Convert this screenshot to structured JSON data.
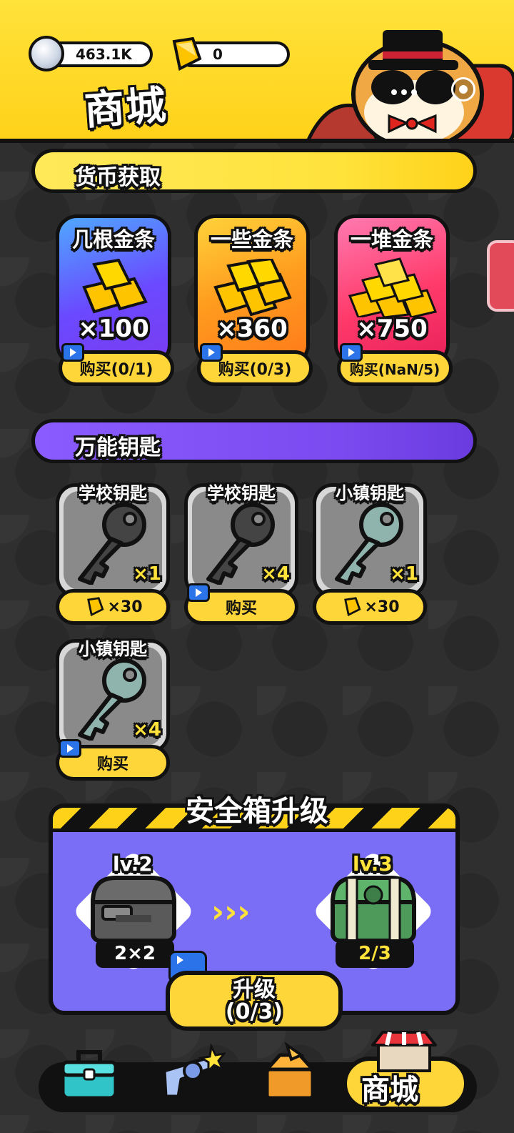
{
  "header": {
    "silver_amount": "463.1K",
    "gold_amount": "0",
    "title": "商城"
  },
  "sections": {
    "currency_title": "货币获取",
    "keys_title": "万能钥匙"
  },
  "gold_packs": [
    {
      "name": "几根金条",
      "qty": "×100",
      "buy": "购买(0/1)",
      "color": "#6a49ff"
    },
    {
      "name": "一些金条",
      "qty": "×360",
      "buy": "购买(0/3)",
      "color": "#ff8a1e"
    },
    {
      "name": "一堆金条",
      "qty": "×750",
      "buy": "购买(NaN/5)",
      "color": "#ff3b6b"
    }
  ],
  "keys": [
    {
      "name": "学校钥匙",
      "qty": "×1",
      "buy": "×30",
      "price_type": "gold-bar",
      "key_color": "#444444"
    },
    {
      "name": "学校钥匙",
      "qty": "×4",
      "buy": "购买",
      "price_type": "video-ad",
      "key_color": "#444444"
    },
    {
      "name": "小镇钥匙",
      "qty": "×1",
      "buy": "×30",
      "price_type": "gold-bar",
      "key_color": "#8fb3ad"
    },
    {
      "name": "小镇钥匙",
      "qty": "×4",
      "buy": "购买",
      "price_type": "video-ad",
      "key_color": "#8fb3ad"
    }
  ],
  "upgrade": {
    "title": "安全箱升级",
    "from_level": "lv.2",
    "from_size": "2×2",
    "to_level": "lv.3",
    "to_size": "2/3",
    "arrows": "›››",
    "button_label": "升级",
    "button_progress": "(0/3)"
  },
  "nav": {
    "shop_label": "商城",
    "items": [
      "toolbox-icon",
      "revolver-icon",
      "box-open-icon",
      "shop-icon"
    ]
  },
  "colors": {
    "header_yellow": "#ffd21a",
    "button_yellow": "#ffd63a",
    "upgrade_purple": "#7b6ef6",
    "background": "#2f2f2f"
  }
}
